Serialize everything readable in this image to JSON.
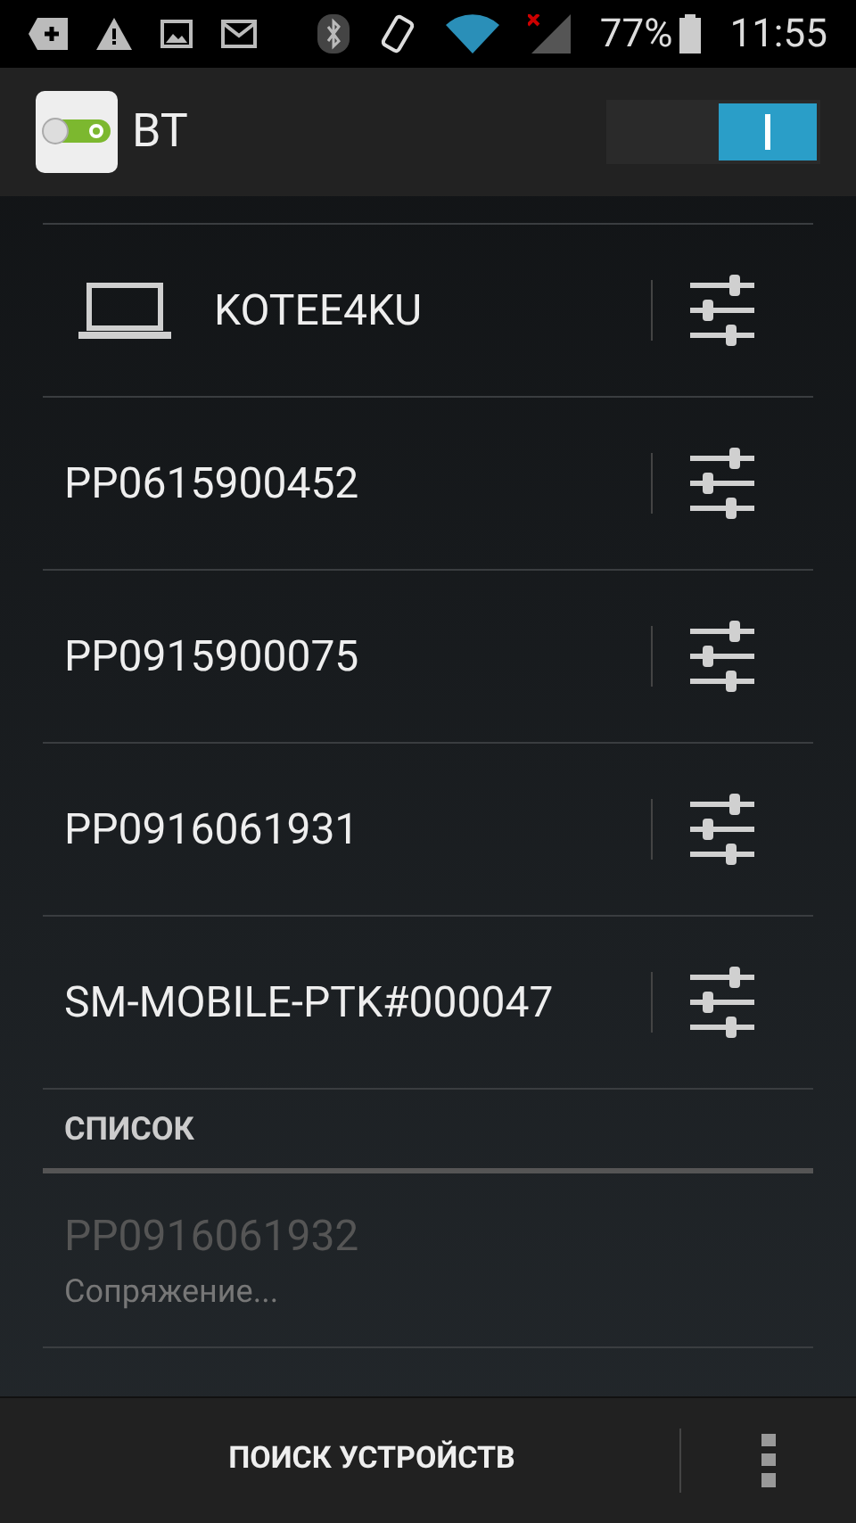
{
  "status_bar": {
    "battery": "77%",
    "time": "11:55"
  },
  "action_bar": {
    "title": "BT",
    "switch": {
      "on": true
    }
  },
  "paired_devices": [
    {
      "name": "KOTEE4KU",
      "kind": "computer"
    },
    {
      "name": "PP0615900452",
      "kind": "plain"
    },
    {
      "name": "PP0915900075",
      "kind": "plain"
    },
    {
      "name": "PP0916061931",
      "kind": "plain"
    },
    {
      "name": "SM-MOBILE-PTK#000047",
      "kind": "plain"
    }
  ],
  "available_section": {
    "title": "СПИСОК",
    "devices": [
      {
        "name": "PP0916061932",
        "status": "Сопряжение...",
        "disabled": true
      }
    ]
  },
  "bottom_bar": {
    "button": "ПОИСК УСТРОЙСТВ"
  }
}
